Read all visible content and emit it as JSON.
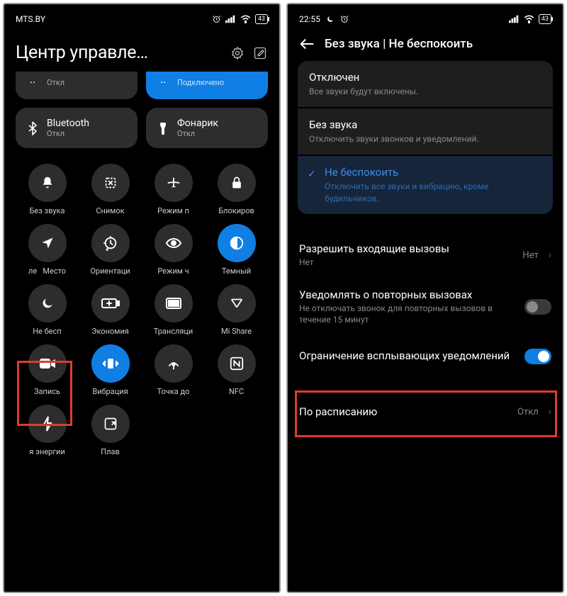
{
  "left": {
    "status": {
      "carrier": "MTS.BY",
      "battery": "43"
    },
    "title": "Центр управле…",
    "bigTiles": [
      {
        "label": "",
        "sub": "Откл",
        "active": false
      },
      {
        "label": "",
        "sub": "Подключено",
        "active": true
      },
      {
        "label": "Bluetooth",
        "sub": "Откл",
        "active": false
      },
      {
        "label": "Фонарик",
        "sub": "Откл",
        "active": false
      }
    ],
    "tiles": [
      {
        "label": "Без звука",
        "icon": "bell"
      },
      {
        "label": "Снимок",
        "icon": "scissors"
      },
      {
        "label": "Режим п",
        "icon": "plane"
      },
      {
        "label": "Блокиров",
        "icon": "lock"
      },
      {
        "label": "Место",
        "prefix": "ле",
        "icon": "location"
      },
      {
        "label": "Ориентаци",
        "icon": "rotate"
      },
      {
        "label": "Режим ч",
        "icon": "eye"
      },
      {
        "label": "Темный",
        "icon": "dark",
        "active": true
      },
      {
        "label": "Не бесп",
        "icon": "moon"
      },
      {
        "label": "Экономия",
        "icon": "battery"
      },
      {
        "label": "Трансляци",
        "icon": "cast"
      },
      {
        "label": "Mi Share",
        "icon": "mishare"
      },
      {
        "label": "Запись",
        "icon": "record"
      },
      {
        "label": "Вибрация",
        "icon": "vibrate",
        "active": true
      },
      {
        "label": "Точка до",
        "icon": "hotspot"
      },
      {
        "label": "NFC",
        "icon": "nfc"
      },
      {
        "label": "я энергии",
        "icon": "bolt"
      },
      {
        "label": "Плав",
        "icon": "float"
      }
    ]
  },
  "right": {
    "status": {
      "time": "22:55",
      "battery": "43"
    },
    "header": "Без звука | Не беспокоить",
    "modes": [
      {
        "title": "Отключен",
        "sub": "Все звуки будут включены."
      },
      {
        "title": "Без звука",
        "sub": "Отключить звуки звонков и уведомлений."
      },
      {
        "title": "Не беспокоить",
        "sub": "Отключить все звуки и вибрацию, кроме будильников.",
        "selected": true
      }
    ],
    "rows": {
      "incoming": {
        "title": "Разрешить входящие вызовы",
        "sub": "Нет",
        "value": "Нет"
      },
      "repeat": {
        "title": "Уведомлять о повторных вызовах",
        "sub": "Не отключать звонок для повторных вызовов в течение 15 минут"
      },
      "popup": {
        "title": "Ограничение всплывающих уведомлений"
      },
      "schedule": {
        "title": "По расписанию",
        "value": "Откл"
      }
    }
  }
}
